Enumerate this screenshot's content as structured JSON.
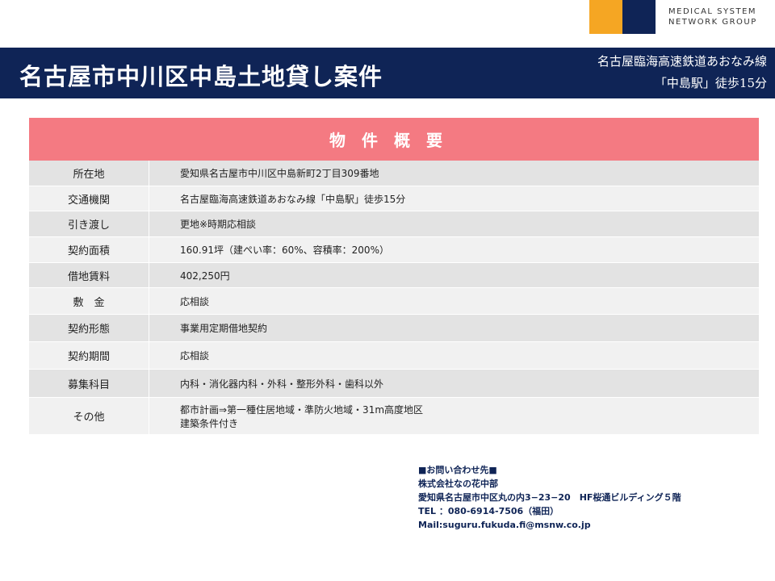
{
  "logo": {
    "line1": "MEDICAL SYSTEM",
    "line2": "NETWORK GROUP"
  },
  "title": "名古屋市中川区中島土地貸し案件",
  "access": {
    "line1": "名古屋臨海高速鉄道あおなみ線",
    "line2": "「中島駅」徒歩15分"
  },
  "table": {
    "header": "物件概要",
    "rows": [
      {
        "label": "所在地",
        "value": "愛知県名古屋市中川区中島新町2丁目309番地"
      },
      {
        "label": "交通機関",
        "value": "名古屋臨海高速鉄道あおなみ線「中島駅」徒歩15分"
      },
      {
        "label": "引き渡し",
        "value": "更地※時期応相談"
      },
      {
        "label": "契約面積",
        "value": "160.91坪（建ぺい率：60%、容積率：200%）"
      },
      {
        "label": "借地賃料",
        "value": "402,250円"
      },
      {
        "label": "敷　金",
        "value": "応相談"
      },
      {
        "label": "契約形態",
        "value": "事業用定期借地契約"
      },
      {
        "label": "契約期間",
        "value": "応相談"
      },
      {
        "label": "募集科目",
        "value": "内科・消化器内科・外科・整形外科・歯科以外"
      },
      {
        "label": "その他",
        "value": "都市計画⇒第一種住居地域・準防火地域・31m高度地区",
        "value2": "建築条件付き"
      }
    ]
  },
  "contact": {
    "line1": "■お問い合わせ先■",
    "line2": "株式会社なの花中部",
    "line3": "愛知県名古屋市中区丸の内3−23−20　HF桜通ビルディング５階",
    "line4": "TEL ：080-6914-7506（福田）",
    "line5": "Mail:suguru.fukuda.fi@msnw.co.jp"
  },
  "colors": {
    "navy": "#0f2456",
    "orange": "#f5a623",
    "header_pink": "#f47a82"
  }
}
